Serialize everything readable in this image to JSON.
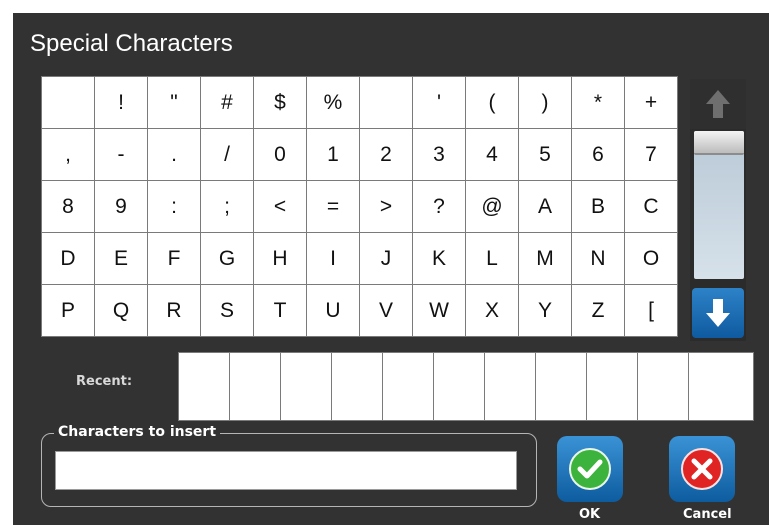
{
  "dialog": {
    "title": "Special Characters"
  },
  "characters": [
    "",
    "!",
    "\"",
    "#",
    "$",
    "%",
    "",
    "'",
    "(",
    ")",
    "*",
    "+",
    ",",
    "-",
    ".",
    "/",
    "0",
    "1",
    "2",
    "3",
    "4",
    "5",
    "6",
    "7",
    "8",
    "9",
    ":",
    ";",
    "<",
    "=",
    ">",
    "?",
    "@",
    "A",
    "B",
    "C",
    "D",
    "E",
    "F",
    "G",
    "H",
    "I",
    "J",
    "K",
    "L",
    "M",
    "N",
    "O",
    "P",
    "Q",
    "R",
    "S",
    "T",
    "U",
    "V",
    "W",
    "X",
    "Y",
    "Z",
    "["
  ],
  "recent": {
    "label": "Recent:",
    "slots": [
      "",
      "",
      "",
      "",
      "",
      "",
      "",
      "",
      "",
      "",
      ""
    ]
  },
  "insert": {
    "label": "Characters to insert",
    "value": ""
  },
  "buttons": {
    "ok_label": "OK",
    "cancel_label": "Cancel"
  },
  "icons": {
    "scroll_up": "arrow-up-icon",
    "scroll_down": "arrow-down-icon",
    "ok": "checkmark-icon",
    "cancel": "x-icon"
  },
  "colors": {
    "background": "#323232",
    "accent_blue": "#1f6fb5",
    "ok_green": "#3cb33c",
    "cancel_red": "#e02424"
  }
}
